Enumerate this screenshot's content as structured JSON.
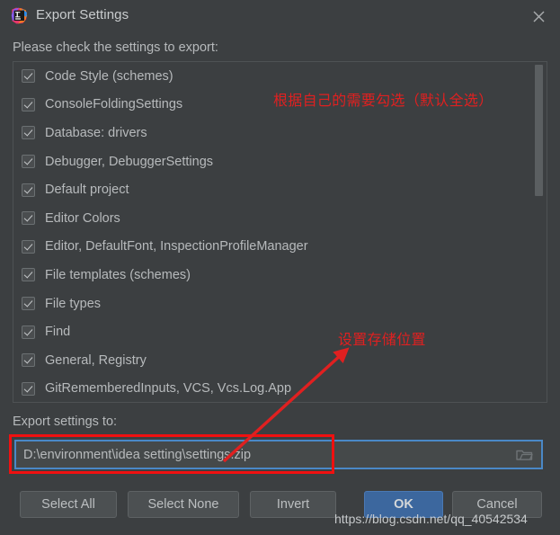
{
  "window": {
    "title": "Export Settings",
    "icon": "intellij-idea-logo",
    "close_icon": "close-icon"
  },
  "prompt": "Please check the settings to export:",
  "list": {
    "items": [
      {
        "label": "Code Style (schemes)",
        "checked": true
      },
      {
        "label": "ConsoleFoldingSettings",
        "checked": true
      },
      {
        "label": "Database: drivers",
        "checked": true
      },
      {
        "label": "Debugger, DebuggerSettings",
        "checked": true
      },
      {
        "label": "Default project",
        "checked": true
      },
      {
        "label": "Editor Colors",
        "checked": true
      },
      {
        "label": "Editor, DefaultFont, InspectionProfileManager",
        "checked": true
      },
      {
        "label": "File templates (schemes)",
        "checked": true
      },
      {
        "label": "File types",
        "checked": true
      },
      {
        "label": "Find",
        "checked": true
      },
      {
        "label": "General, Registry",
        "checked": true
      },
      {
        "label": "GitRememberedInputs, VCS, Vcs.Log.App",
        "checked": true
      },
      {
        "label": "",
        "checked": true
      }
    ]
  },
  "export": {
    "label": "Export settings to:",
    "path_value": "D:\\environment\\idea setting\\settings.zip",
    "path_placeholder": "",
    "browse_icon": "folder-icon"
  },
  "buttons": {
    "select_all": "Select All",
    "select_none": "Select None",
    "invert": "Invert",
    "ok": "OK",
    "cancel": "Cancel"
  },
  "annotations": {
    "top_note": "根据自己的需要勾选（默认全选）",
    "mid_note": "设置存储位置",
    "watermark": "https://blog.csdn.net/qq_40542534",
    "highlight_color": "#F01010",
    "note_color": "#E02020"
  },
  "colors": {
    "window_bg": "#3C3F41",
    "accent_blue": "#4A88C7",
    "ok_button": "#3C679E",
    "text": "#B7BABC"
  }
}
